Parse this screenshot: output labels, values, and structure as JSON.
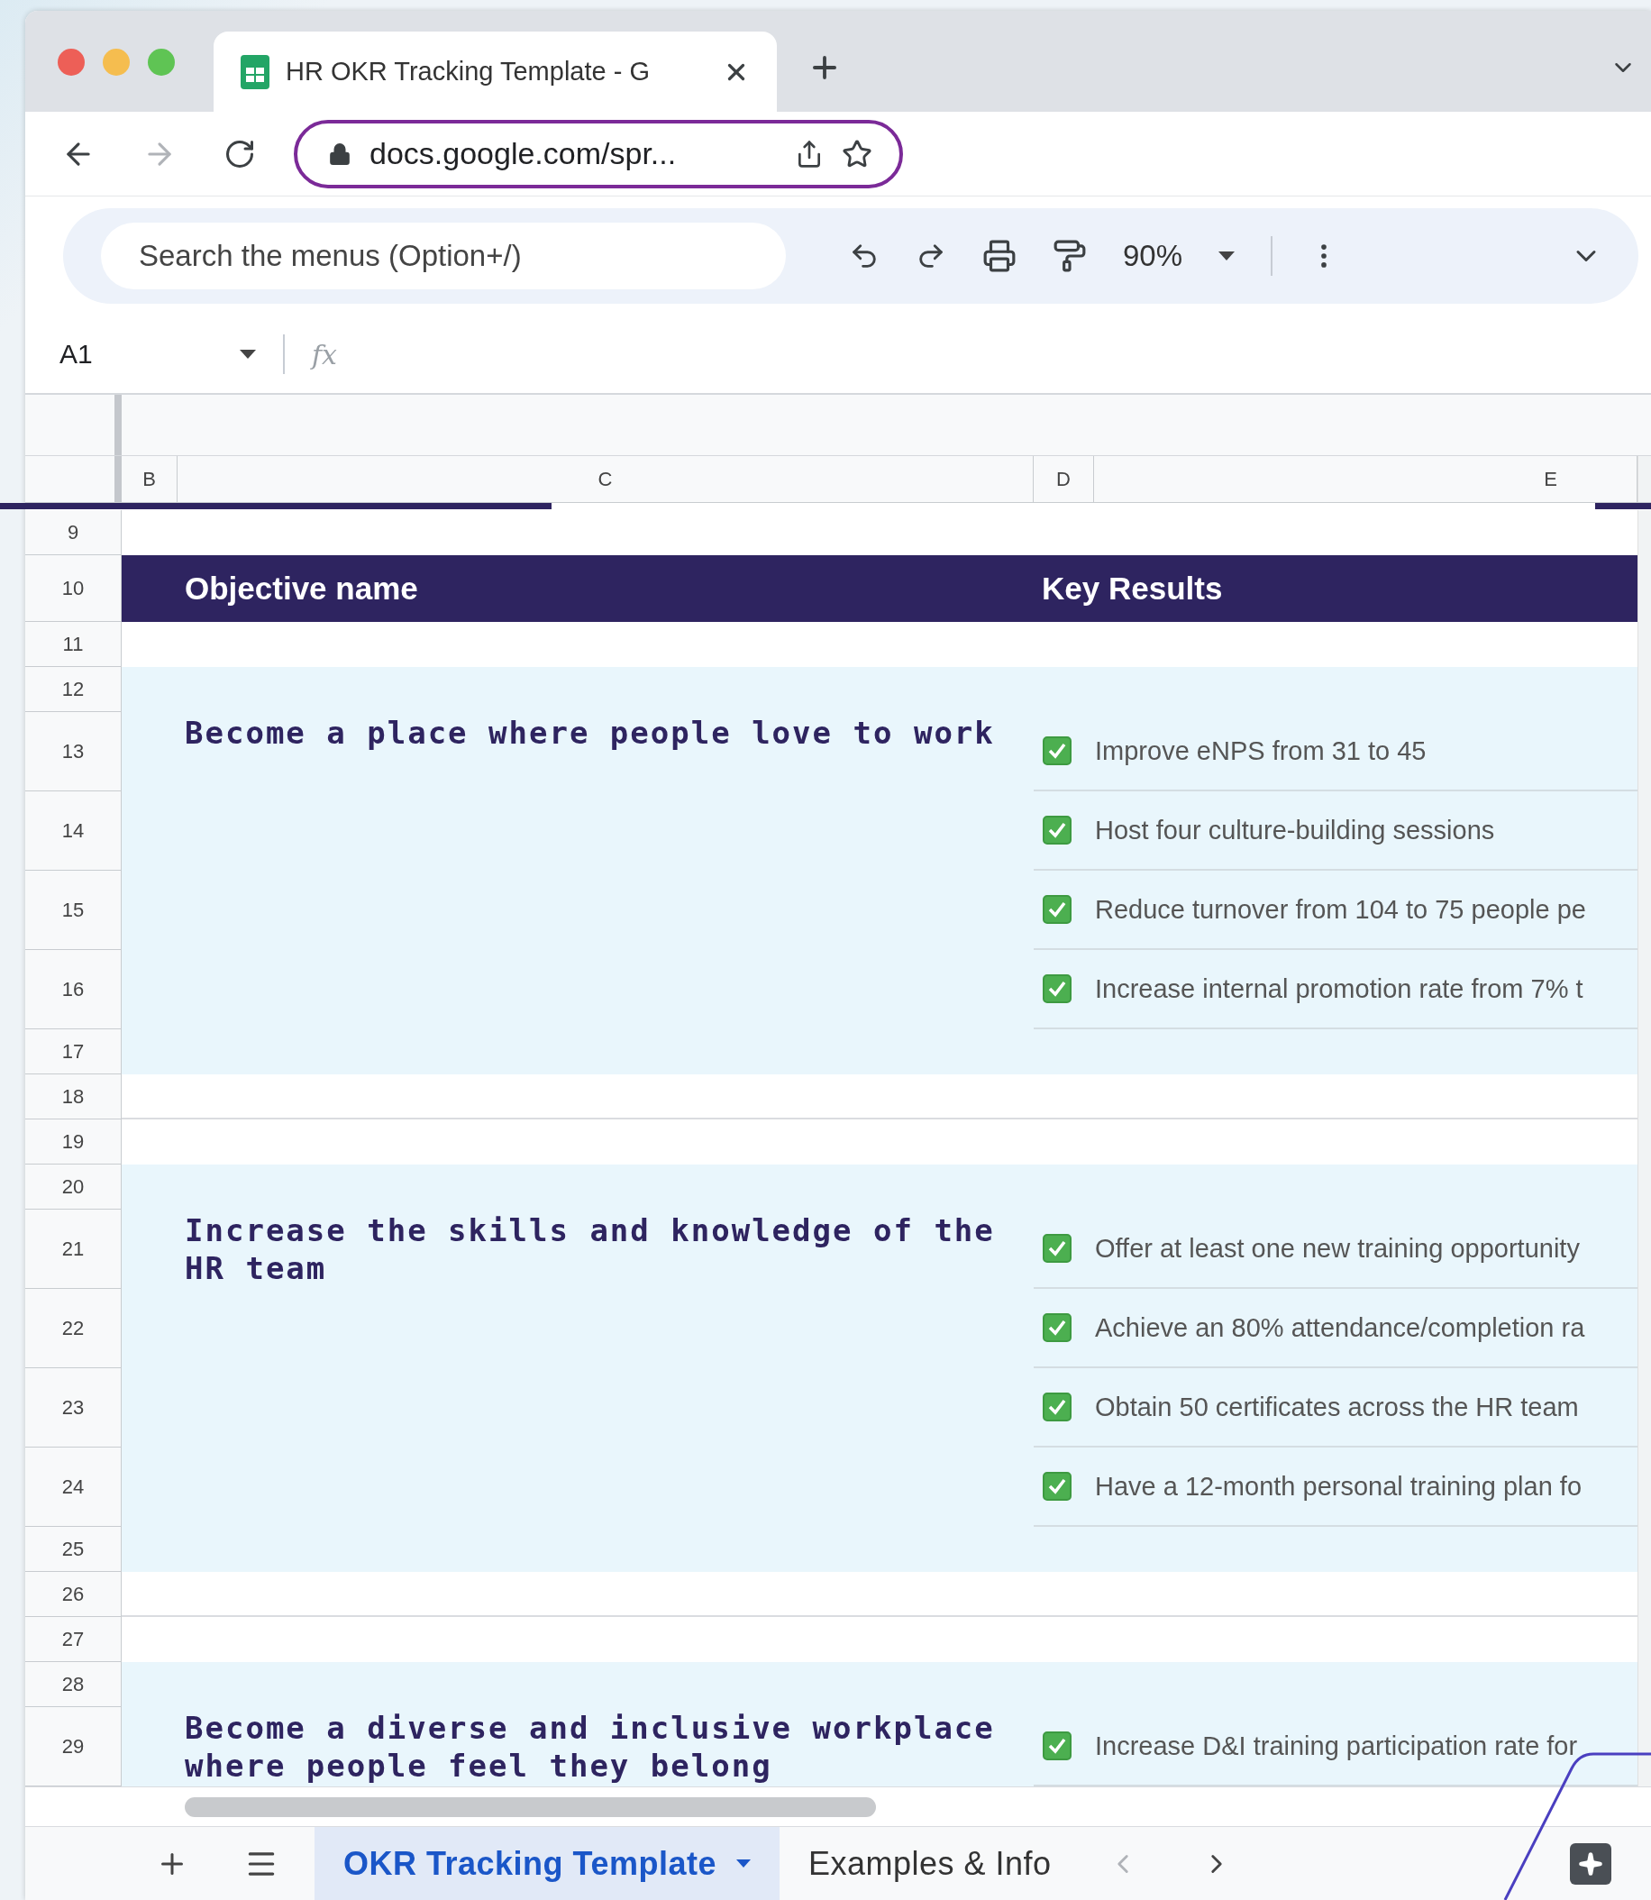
{
  "browser": {
    "tab_title": "HR OKR Tracking Template - G",
    "url": "docs.google.com/spr..."
  },
  "toolbar": {
    "search_placeholder": "Search the menus (Option+/)",
    "zoom": "90%"
  },
  "formula_bar": {
    "cell_ref": "A1",
    "fx": "fx"
  },
  "columns": [
    {
      "label": "B",
      "kind": "narrow"
    },
    {
      "label": "C",
      "kind": "wide"
    },
    {
      "label": "D",
      "kind": "narrow"
    },
    {
      "label": "E",
      "kind": "rest"
    }
  ],
  "rows": [
    {
      "number": "9",
      "kind": "short"
    },
    {
      "number": "10",
      "kind": "header"
    },
    {
      "number": "11",
      "kind": "short"
    },
    {
      "number": "12",
      "kind": "short"
    },
    {
      "number": "13",
      "kind": "tall"
    },
    {
      "number": "14",
      "kind": "tall"
    },
    {
      "number": "15",
      "kind": "tall"
    },
    {
      "number": "16",
      "kind": "tall"
    },
    {
      "number": "17",
      "kind": "short"
    },
    {
      "number": "18",
      "kind": "short"
    },
    {
      "number": "19",
      "kind": "short"
    },
    {
      "number": "20",
      "kind": "short"
    },
    {
      "number": "21",
      "kind": "tall"
    },
    {
      "number": "22",
      "kind": "tall"
    },
    {
      "number": "23",
      "kind": "tall"
    },
    {
      "number": "24",
      "kind": "tall"
    },
    {
      "number": "25",
      "kind": "short"
    },
    {
      "number": "26",
      "kind": "short"
    },
    {
      "number": "27",
      "kind": "short"
    },
    {
      "number": "28",
      "kind": "short"
    },
    {
      "number": "29",
      "kind": "tall"
    }
  ],
  "header": {
    "objective": "Objective name",
    "key_results": "Key Results"
  },
  "objectives": [
    {
      "title": "Become a place where people love to work",
      "key_results": [
        {
          "text": "Improve eNPS from 31 to 45",
          "checked": true
        },
        {
          "text": "Host four culture-building sessions",
          "checked": true
        },
        {
          "text": "Reduce turnover from 104 to 75 people pe",
          "checked": true
        },
        {
          "text": "Increase internal promotion rate from 7% t",
          "checked": true
        }
      ]
    },
    {
      "title": "Increase the skills and knowledge of the HR team",
      "key_results": [
        {
          "text": "Offer at least one new training opportunity",
          "checked": true
        },
        {
          "text": "Achieve an 80% attendance/completion ra",
          "checked": true
        },
        {
          "text": "Obtain 50 certificates across the HR team",
          "checked": true
        },
        {
          "text": "Have a 12-month personal training plan fo",
          "checked": true
        }
      ]
    },
    {
      "title": "Become a diverse and inclusive workplace where people feel they belong",
      "key_results": [
        {
          "text": "Increase D&I training participation rate for",
          "checked": true
        }
      ]
    }
  ],
  "sheet_tabs": [
    {
      "label": "OKR Tracking Template",
      "selected": true
    },
    {
      "label": "Examples & Info",
      "selected": false
    }
  ]
}
